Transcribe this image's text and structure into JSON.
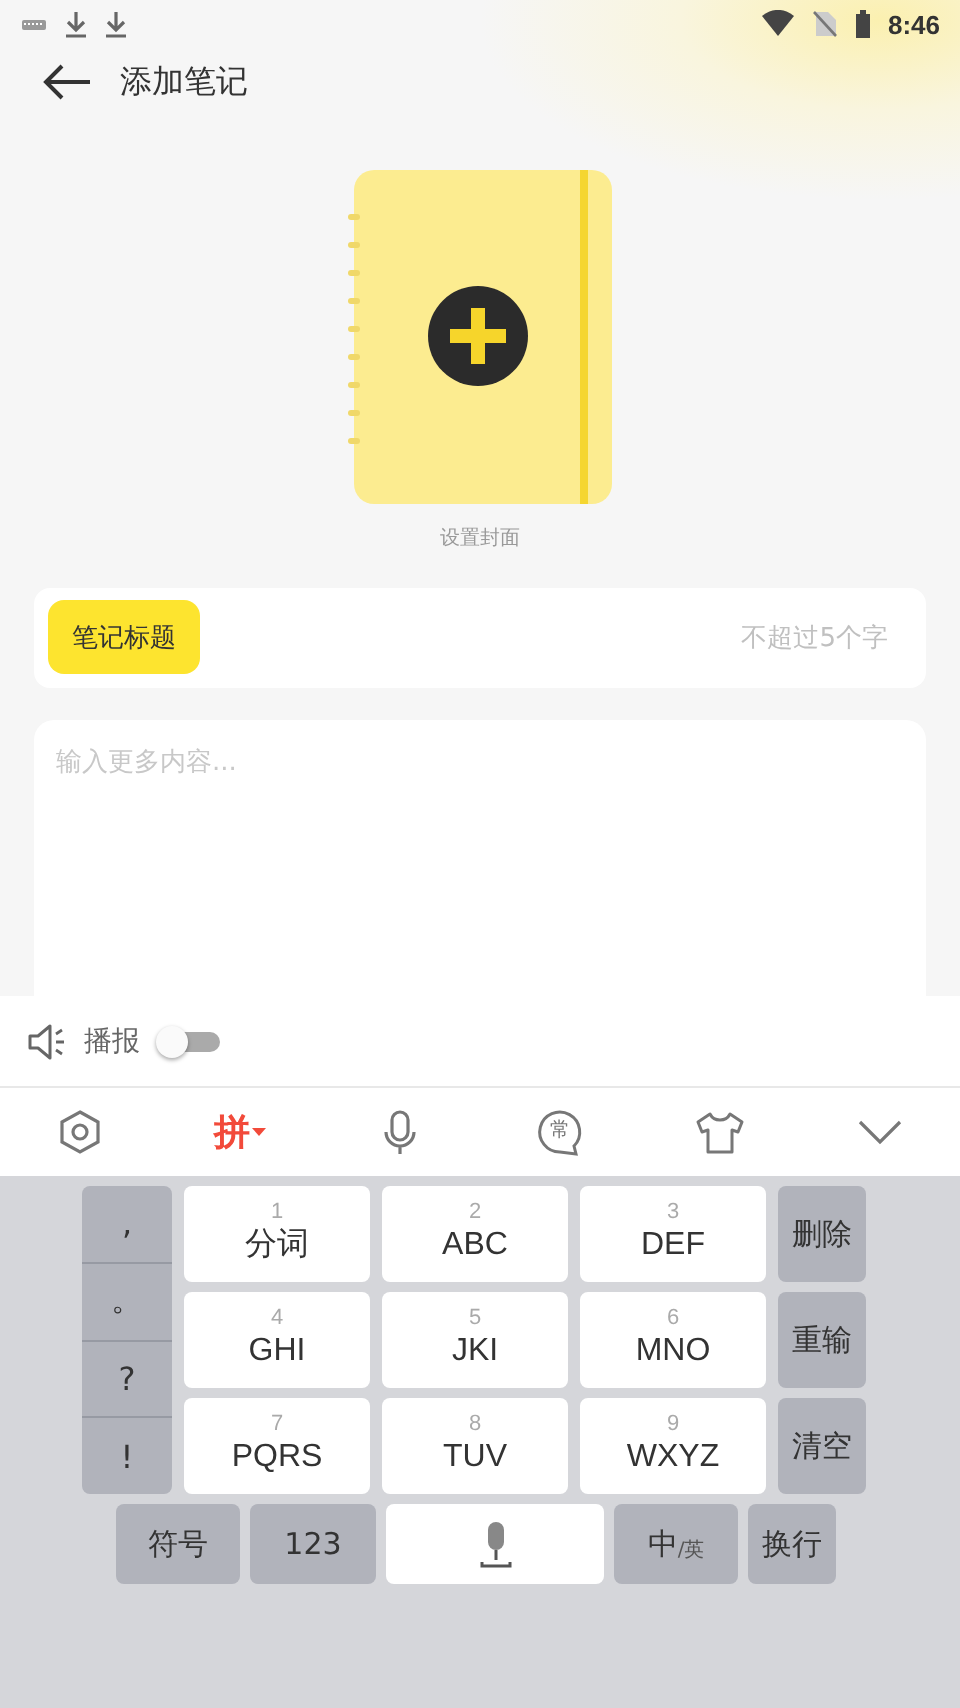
{
  "status_bar": {
    "time": "8:46"
  },
  "header": {
    "title": "添加笔记"
  },
  "cover": {
    "label": "设置封面"
  },
  "title_field": {
    "label": "笔记标题",
    "placeholder": "不超过5个字"
  },
  "content_field": {
    "placeholder": "输入更多内容..."
  },
  "speech": {
    "label": "播报",
    "on": false
  },
  "ime_toolbar": [
    {
      "kind": "settings",
      "selected": false
    },
    {
      "kind": "text",
      "label": "拼",
      "selected": true
    },
    {
      "kind": "mic",
      "selected": false
    },
    {
      "kind": "bubble",
      "label": "常",
      "selected": false
    },
    {
      "kind": "shirt",
      "selected": false
    },
    {
      "kind": "collapse",
      "selected": false
    }
  ],
  "punctuation": [
    ",",
    "。",
    "?",
    "!"
  ],
  "keys": [
    {
      "digit": "1",
      "letters": "分词"
    },
    {
      "digit": "2",
      "letters": "ABC"
    },
    {
      "digit": "3",
      "letters": "DEF"
    },
    {
      "digit": "4",
      "letters": "GHI"
    },
    {
      "digit": "5",
      "letters": "JKI"
    },
    {
      "digit": "6",
      "letters": "MNO"
    },
    {
      "digit": "7",
      "letters": "PQRS"
    },
    {
      "digit": "8",
      "letters": "TUV"
    },
    {
      "digit": "9",
      "letters": "WXYZ"
    }
  ],
  "side_keys": [
    "删除",
    "重输",
    "清空"
  ],
  "bottom_keys": [
    {
      "kind": "text",
      "label": "符号"
    },
    {
      "kind": "text",
      "label": "123"
    },
    {
      "kind": "space"
    },
    {
      "kind": "lang",
      "label": "中",
      "sub": "/英"
    },
    {
      "kind": "text",
      "label": "换行"
    }
  ]
}
